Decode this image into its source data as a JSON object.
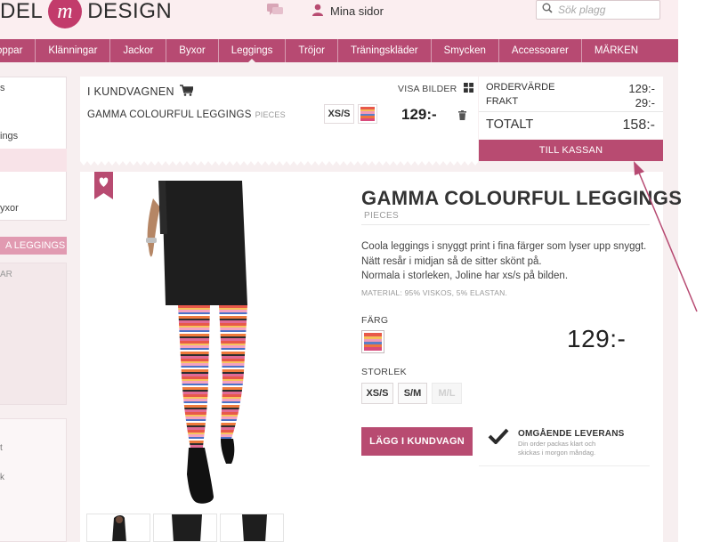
{
  "header": {
    "logo_left": "DEL",
    "logo_mark": "m",
    "logo_right": "DESIGN",
    "account_label": "Mina sidor",
    "search_placeholder": "Sök plagg"
  },
  "nav": [
    "oppar",
    "Klänningar",
    "Jackor",
    "Byxor",
    "Leggings",
    "Tröjor",
    "Träningskläder",
    "Smycken",
    "Accessoarer",
    "MÄRKEN"
  ],
  "sidebar": {
    "line1": "s",
    "line2": "ings",
    "line3": "yxor",
    "tag": "A LEGGINGS",
    "box_label": "AR",
    "line4": "t",
    "line5": "k"
  },
  "cart": {
    "title": "I KUNDVAGNEN",
    "view_images_label": "VISA BILDER",
    "item": {
      "name": "GAMMA COLOURFUL LEGGINGS",
      "brand": "PIECES",
      "size": "XS/S",
      "price": "129:-"
    }
  },
  "totals": {
    "order_value_label": "ORDERVÄRDE",
    "order_value": "129:-",
    "shipping_label": "FRAKT",
    "shipping": "29:-",
    "total_label": "TOTALT",
    "total": "158:-",
    "checkout_label": "TILL KASSAN"
  },
  "product": {
    "title": "GAMMA COLOURFUL LEGGINGS",
    "brand": "PIECES",
    "description": [
      "Coola leggings i snyggt print i fina färger som lyser upp snyggt.",
      "Nätt resår i midjan så de sitter skönt på.",
      "Normala i storleken, Joline har xs/s på bilden."
    ],
    "material": "MATERIAL: 95% VISKOS, 5% ELASTAN.",
    "color_label": "FÄRG",
    "price": "129:-",
    "size_label": "STORLEK",
    "sizes": [
      {
        "label": "XS/S",
        "available": true
      },
      {
        "label": "S/M",
        "available": true
      },
      {
        "label": "M/L",
        "available": false
      }
    ],
    "add_to_cart_label": "LÄGG I KUNDVAGN",
    "delivery_title": "OMGÅENDE LEVERANS",
    "delivery_note": [
      "Din order packas klart och",
      "skickas i morgon måndag."
    ]
  },
  "colors": {
    "brand_pink": "#b84b71",
    "header_bg": "#fbeef0",
    "page_bg": "#f7eff0"
  },
  "icons": [
    "chat-icon",
    "user-icon",
    "search-icon",
    "cart-icon",
    "grid-icon",
    "trash-icon",
    "heart-bookmark-icon",
    "checkmark-icon"
  ]
}
